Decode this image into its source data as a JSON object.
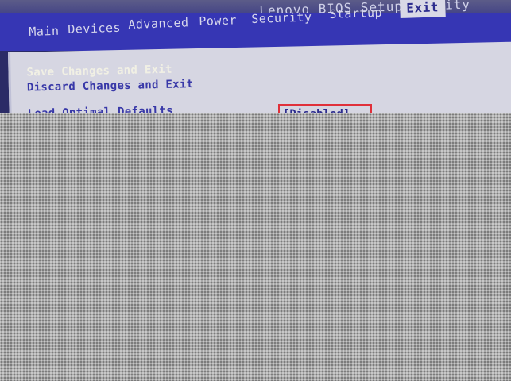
{
  "window": {
    "title": "Lenovo BIOS Setup Utility"
  },
  "menu_bar": {
    "tabs": [
      {
        "label": "Main",
        "active": false
      },
      {
        "label": "Devices",
        "active": false
      },
      {
        "label": "Advanced",
        "active": false
      },
      {
        "label": "Power",
        "active": false
      },
      {
        "label": "Security",
        "active": false
      },
      {
        "label": "Startup",
        "active": false
      },
      {
        "label": "Exit",
        "active": true
      }
    ]
  },
  "exit_menu": {
    "items": [
      {
        "label": "Save Changes and Exit",
        "selected": true
      },
      {
        "label": "Discard Changes and Exit",
        "selected": false
      },
      {
        "label": "Load Optimal Defaults",
        "selected": false
      }
    ]
  },
  "highlight": {
    "text": "[Disabled]",
    "border_color": "#e0303a"
  },
  "colors": {
    "menu_bar_bg": "#3636b4",
    "panel_bg": "#d6d6e2",
    "item_text": "#3838a8",
    "selected_text": "#f1f0e4",
    "active_tab_bg": "#d9d9e6"
  }
}
